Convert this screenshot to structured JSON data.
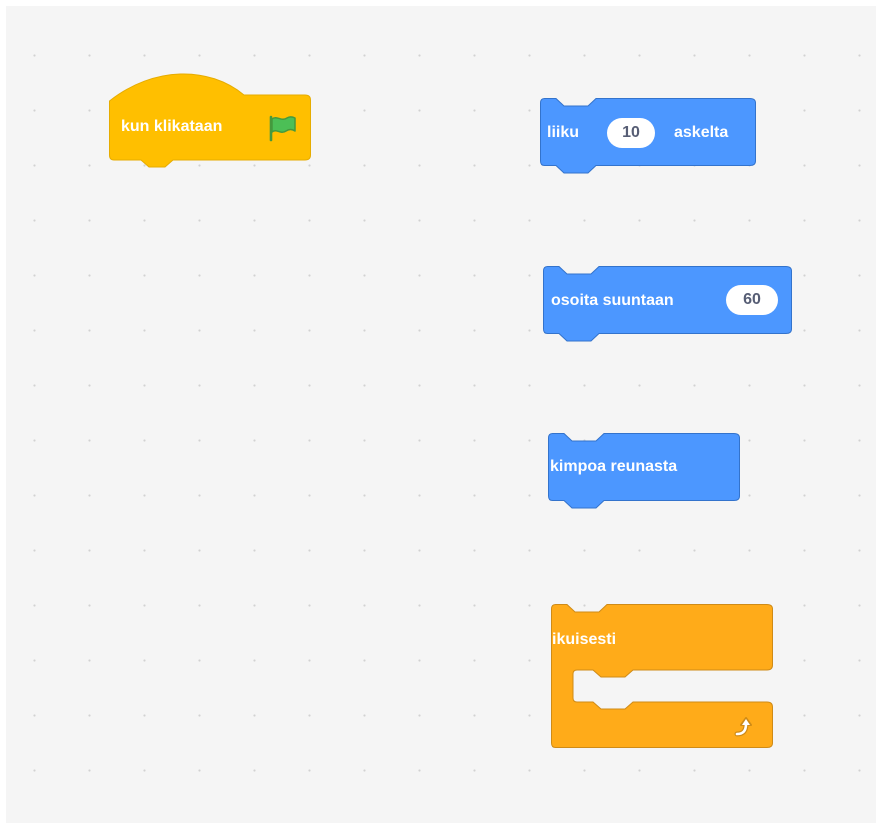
{
  "workspace": {
    "background": "#f5f5f5",
    "grid_dot_color": "#d2d2d2"
  },
  "blocks": {
    "when_flag_clicked": {
      "label": "kun klikataan",
      "icon": "green-flag-icon",
      "category": "events",
      "color": "#ffbf00",
      "border": "#e6ac00"
    },
    "move_steps": {
      "label_before": "liiku",
      "value": "10",
      "label_after": "askelta",
      "category": "motion",
      "color": "#4c97ff",
      "border": "#3373cc"
    },
    "point_in_direction": {
      "label": "osoita suuntaan",
      "value": "60",
      "category": "motion",
      "color": "#4c97ff",
      "border": "#3373cc"
    },
    "bounce_on_edge": {
      "label": "kimpoa reunasta",
      "category": "motion",
      "color": "#4c97ff",
      "border": "#3373cc"
    },
    "forever": {
      "label": "ikuisesti",
      "icon": "loop-arrow-icon",
      "category": "control",
      "color": "#ffab19",
      "border": "#cf8b17"
    }
  }
}
